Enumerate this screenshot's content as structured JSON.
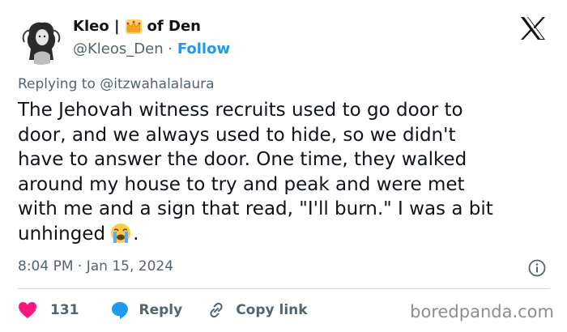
{
  "author": {
    "name_part1": "Kleo |",
    "name_part2": "of Den",
    "handle": "@Kleos_Den",
    "separator": "·",
    "follow_label": "Follow",
    "crown_icon": "crown-emoji"
  },
  "reply": {
    "prefix": "Replying to",
    "mention": "@itzwahalalaura"
  },
  "tweet": {
    "lines": [
      "The Jehovah witness recruits used to go door to",
      "door, and we always used to hide, so we didn't",
      "have to answer the door. One time, they walked",
      "around my house to try and peak and were met",
      "with me and a sign that read, \"I'll burn.\" I was a bit",
      "unhinged"
    ],
    "last_suffix": ".",
    "emoji": "loudly-crying-face-emoji"
  },
  "timestamp": "8:04 PM · Jan 15, 2024",
  "actions": {
    "like_count": "131",
    "reply_label": "Reply",
    "copy_label": "Copy link"
  },
  "watermark": "boredpanda.com",
  "colors": {
    "text": "#0f1419",
    "muted": "#536471",
    "link": "#1d9bf0",
    "heart": "#f91880",
    "reply_bubble": "#1d9bf0",
    "divider": "#cfd9de"
  }
}
